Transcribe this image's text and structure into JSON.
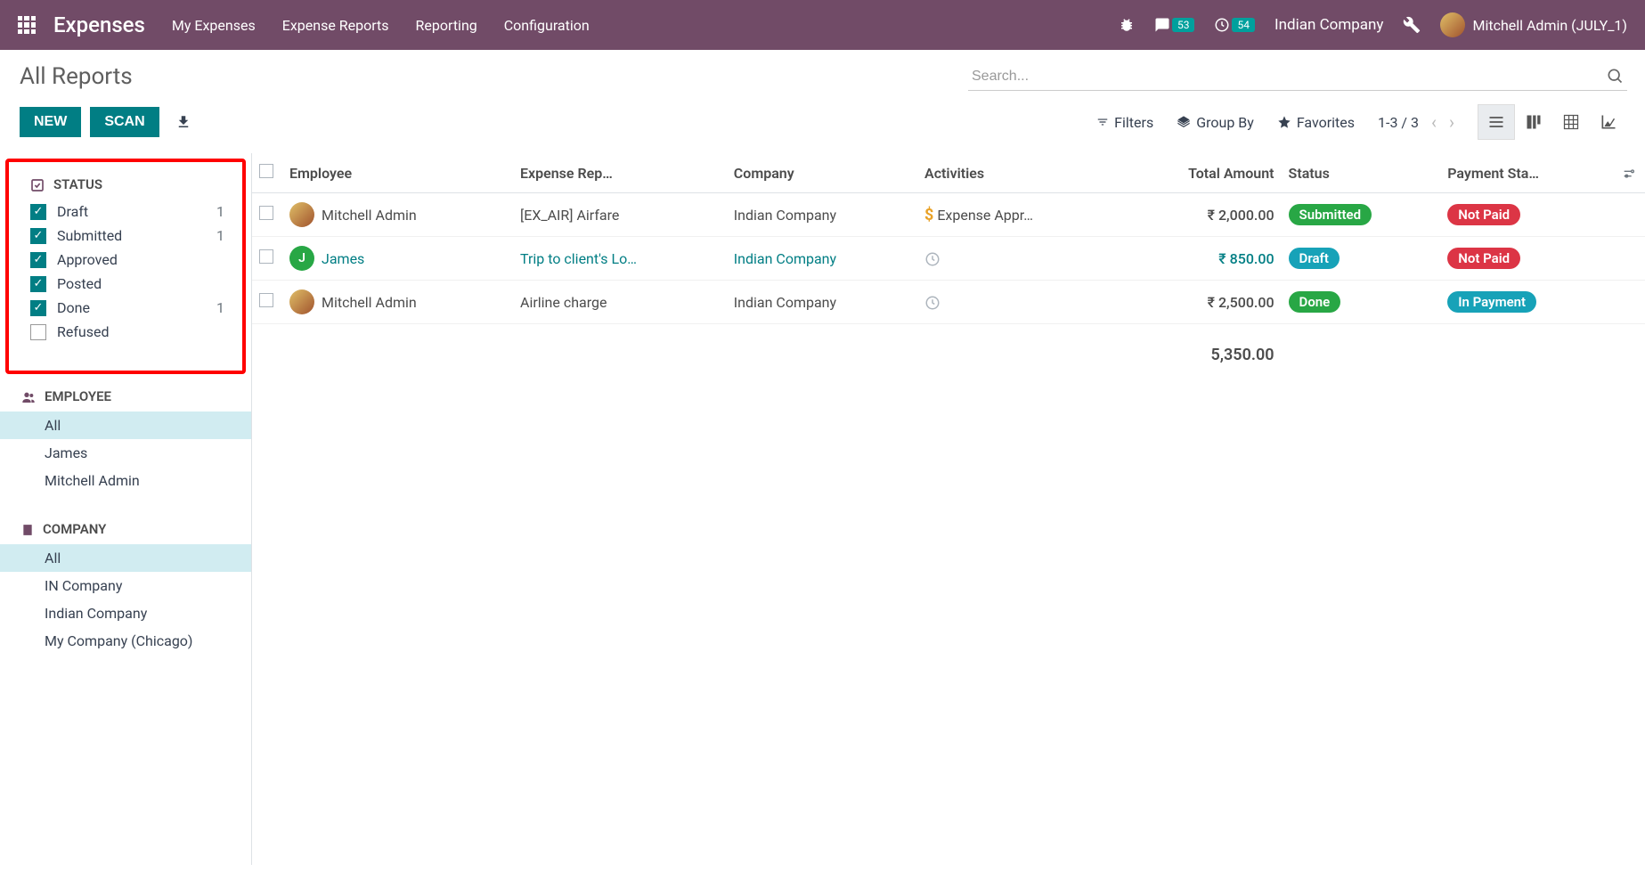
{
  "topnav": {
    "brand": "Expenses",
    "menu": [
      "My Expenses",
      "Expense Reports",
      "Reporting",
      "Configuration"
    ],
    "messages_badge": "53",
    "activities_badge": "54",
    "company": "Indian Company",
    "user": "Mitchell Admin (JULY_1)"
  },
  "control": {
    "title": "All Reports",
    "search_placeholder": "Search...",
    "new_btn": "NEW",
    "scan_btn": "SCAN",
    "filters": "Filters",
    "groupby": "Group By",
    "favorites": "Favorites",
    "pager": "1-3 / 3"
  },
  "sidebar": {
    "status": {
      "title": "STATUS",
      "items": [
        {
          "label": "Draft",
          "checked": true,
          "count": "1"
        },
        {
          "label": "Submitted",
          "checked": true,
          "count": "1"
        },
        {
          "label": "Approved",
          "checked": true,
          "count": ""
        },
        {
          "label": "Posted",
          "checked": true,
          "count": ""
        },
        {
          "label": "Done",
          "checked": true,
          "count": "1"
        },
        {
          "label": "Refused",
          "checked": false,
          "count": ""
        }
      ]
    },
    "employee": {
      "title": "EMPLOYEE",
      "items": [
        {
          "label": "All",
          "selected": true
        },
        {
          "label": "James",
          "selected": false
        },
        {
          "label": "Mitchell Admin",
          "selected": false
        }
      ]
    },
    "company": {
      "title": "COMPANY",
      "items": [
        {
          "label": "All",
          "selected": true
        },
        {
          "label": "IN Company",
          "selected": false
        },
        {
          "label": "Indian Company",
          "selected": false
        },
        {
          "label": "My Company (Chicago)",
          "selected": false
        }
      ]
    }
  },
  "table": {
    "headers": {
      "employee": "Employee",
      "report": "Expense Rep…",
      "company": "Company",
      "activities": "Activities",
      "total": "Total Amount",
      "status": "Status",
      "payment": "Payment Sta…"
    },
    "rows": [
      {
        "employee": "Mitchell Admin",
        "avatar_type": "img",
        "report": "[EX_AIR] Airfare",
        "company": "Indian Company",
        "activity_icon": "dollar",
        "activity_text": "Expense Appr…",
        "total": "₹ 2,000.00",
        "status": "Submitted",
        "status_class": "pill-submitted",
        "payment": "Not Paid",
        "payment_class": "pill-notpaid",
        "link": false
      },
      {
        "employee": "James",
        "avatar_type": "letter",
        "avatar_letter": "J",
        "report": "Trip to client's Lo…",
        "company": "Indian Company",
        "activity_icon": "clock",
        "activity_text": "",
        "total": "₹ 850.00",
        "status": "Draft",
        "status_class": "pill-draft",
        "payment": "Not Paid",
        "payment_class": "pill-notpaid",
        "link": true
      },
      {
        "employee": "Mitchell Admin",
        "avatar_type": "img",
        "report": "Airline charge",
        "company": "Indian Company",
        "activity_icon": "clock",
        "activity_text": "",
        "total": "₹ 2,500.00",
        "status": "Done",
        "status_class": "pill-done",
        "payment": "In Payment",
        "payment_class": "pill-inpayment",
        "link": false
      }
    ],
    "footer_total": "5,350.00"
  }
}
